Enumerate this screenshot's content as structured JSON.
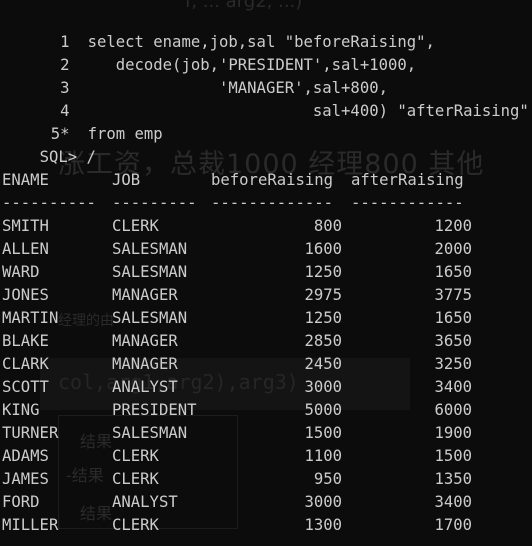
{
  "ghost": {
    "top": "f, ... arg2, ...)",
    "heading": "涨工资，总裁1000 经理800 其他",
    "small": "经理的由",
    "code": "col,arg1,arg2),arg3)",
    "res1": "结果",
    "res2": "-结果",
    "res3": "结果"
  },
  "sql_lines": [
    {
      "num": "1",
      "text": "select ename,job,sal \"beforeRaising\","
    },
    {
      "num": "2",
      "text": "   decode(job,'PRESIDENT',sal+1000,"
    },
    {
      "num": "3",
      "text": "              'MANAGER',sal+800,"
    },
    {
      "num": "4",
      "text": "                        sal+400) \"afterRaising\""
    },
    {
      "num": "5*",
      "text": "from emp"
    }
  ],
  "prompt": {
    "label": "SQL>",
    "command": "/"
  },
  "table": {
    "headers": [
      "ENAME",
      "JOB",
      "beforeRaising",
      "afterRaising"
    ],
    "separators": [
      "----------",
      "---------",
      "-------------",
      "------------"
    ],
    "rows": [
      [
        "SMITH",
        "CLERK",
        "800",
        "1200"
      ],
      [
        "ALLEN",
        "SALESMAN",
        "1600",
        "2000"
      ],
      [
        "WARD",
        "SALESMAN",
        "1250",
        "1650"
      ],
      [
        "JONES",
        "MANAGER",
        "2975",
        "3775"
      ],
      [
        "MARTIN",
        "SALESMAN",
        "1250",
        "1650"
      ],
      [
        "BLAKE",
        "MANAGER",
        "2850",
        "3650"
      ],
      [
        "CLARK",
        "MANAGER",
        "2450",
        "3250"
      ],
      [
        "SCOTT",
        "ANALYST",
        "3000",
        "3400"
      ],
      [
        "KING",
        "PRESIDENT",
        "5000",
        "6000"
      ],
      [
        "TURNER",
        "SALESMAN",
        "1500",
        "1900"
      ],
      [
        "ADAMS",
        "CLERK",
        "1100",
        "1500"
      ],
      [
        "JAMES",
        "CLERK",
        "950",
        "1350"
      ],
      [
        "FORD",
        "ANALYST",
        "3000",
        "3400"
      ],
      [
        "MILLER",
        "CLERK",
        "1300",
        "1700"
      ]
    ]
  }
}
